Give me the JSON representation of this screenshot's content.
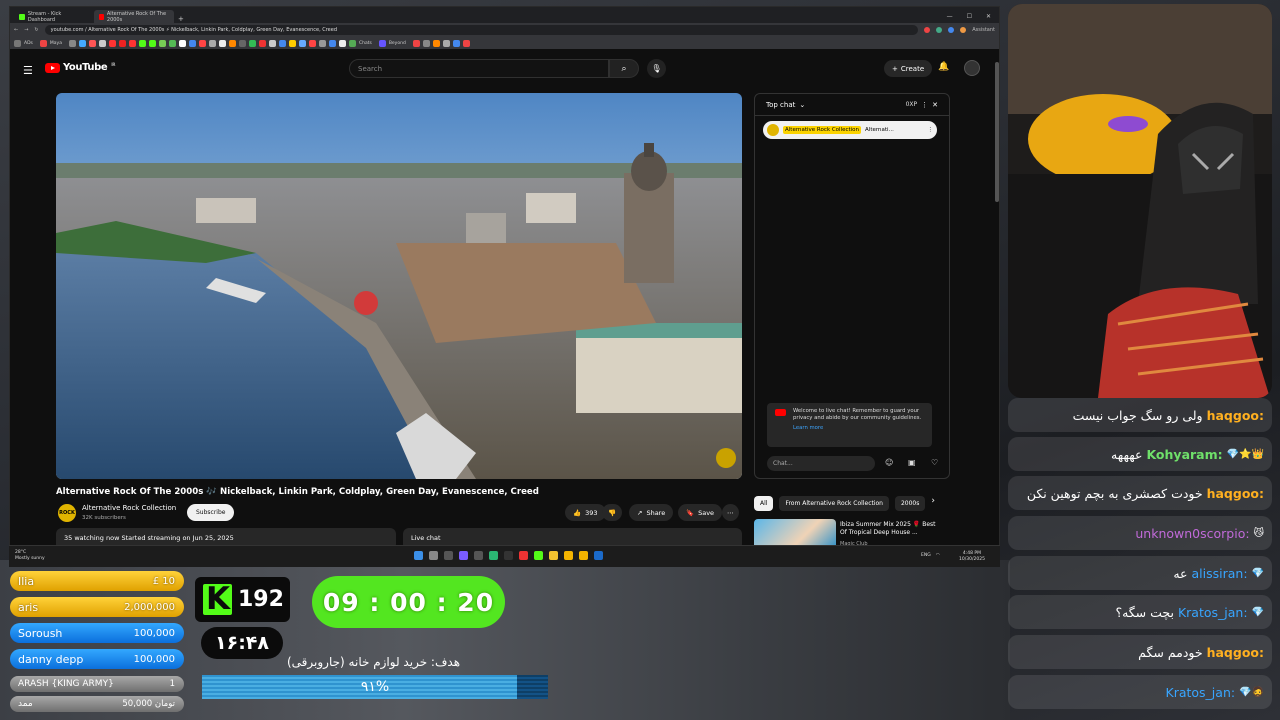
{
  "browser": {
    "tabs": [
      {
        "label": "Stream - Kick Dashboard",
        "color": "#53fc18"
      },
      {
        "label": "Alternative Rock Of The 2000s",
        "color": "#ff0000"
      }
    ],
    "url": "youtube.com / Alternative Rock Of The 2000s ⚡ Nickelback, Linkin Park, Coldplay, Green Day, Evanescence, Creed",
    "assistant_label": "Assistant",
    "bookmarks": [
      "ADs",
      "Maya",
      "Chats",
      "Beyond"
    ]
  },
  "youtube": {
    "logo_text": "YouTube",
    "logo_sup": "IR",
    "search_placeholder": "Search",
    "create_label": "Create",
    "video_title": "Alternative Rock Of The 2000s 🎶 Nickelback, Linkin Park, Coldplay, Green Day, Evanescence, Creed",
    "channel_name": "Alternative Rock Collection",
    "channel_subs": "32K subscribers",
    "subscribe_label": "Subscribe",
    "likes": "393",
    "share_label": "Share",
    "save_label": "Save",
    "info_text": "35 watching now  Started streaming on Jun 25, 2025",
    "live_chat_label": "Live chat",
    "chat": {
      "mode_label": "Top chat",
      "xp_label": "0XP",
      "pinned_channel": "Alternative Rock Collection",
      "pinned_text": "Alternati...",
      "welcome_text": "Welcome to live chat! Remember to guard your privacy and abide by our community guidelines.",
      "learn_more": "Learn more",
      "input_placeholder": "Chat..."
    },
    "chips": [
      "All",
      "From Alternative Rock Collection",
      "2000s"
    ],
    "rec": {
      "title": "Ibiza Summer Mix 2025 🌹 Best Of Tropical Deep House ...",
      "channel": "Magic Club"
    }
  },
  "taskbar": {
    "weather_temp": "28°C",
    "weather_desc": "Mostly sunny",
    "lang": "ENG",
    "time": "4:48 PM",
    "date": "10/30/2025"
  },
  "stream_chat": [
    {
      "user": "haqgoo",
      "user_color": "#ffb020",
      "message": "ولی رو سگ جواب نیست",
      "badges": ""
    },
    {
      "user": "Kohyaram",
      "user_color": "#6fe06a",
      "message": "عهههه",
      "badges": "💎⭐👑"
    },
    {
      "user": "haqgoo",
      "user_color": "#ffb020",
      "message": "خودت کصشری به بچم توهین نکن",
      "badges": ""
    },
    {
      "user": "unknown0scorpio",
      "user_color": "#c06ad8",
      "message": "",
      "badges": "😼"
    },
    {
      "user": "alissiran",
      "user_color": "#38a5ff",
      "message": "عه",
      "badges": "💎"
    },
    {
      "user": "Kratos_jan",
      "user_color": "#38a5ff",
      "message": "بچت سگه؟",
      "badges": "💎"
    },
    {
      "user": "haqgoo",
      "user_color": "#ffb020",
      "message": "خودمم سگم",
      "badges": ""
    },
    {
      "user": "Kratos_jan",
      "user_color": "#38a5ff",
      "message": "",
      "badges": "💎🧔"
    }
  ],
  "donations": [
    {
      "name": "Ilia",
      "amount": "£ 10",
      "style": "gold"
    },
    {
      "name": "aris",
      "amount": "2,000,000",
      "style": "gold"
    },
    {
      "name": "Soroush",
      "amount": "100,000",
      "style": "blue"
    },
    {
      "name": "danny depp",
      "amount": "100,000",
      "style": "blue"
    },
    {
      "name": "ARASH {KING ARMY}",
      "amount": "1",
      "style": "gray"
    },
    {
      "name": "ممد",
      "amount": "50,000 تومان",
      "style": "gray"
    }
  ],
  "kick": {
    "count": "192"
  },
  "timer": "09 : 00 : 20",
  "local_clock": "۱۶:۴۸",
  "goal": {
    "label": "هدف: خرید لوازم خانه (جاروبرقی)",
    "percent_text": "۹۱%",
    "progress": 0.91
  }
}
